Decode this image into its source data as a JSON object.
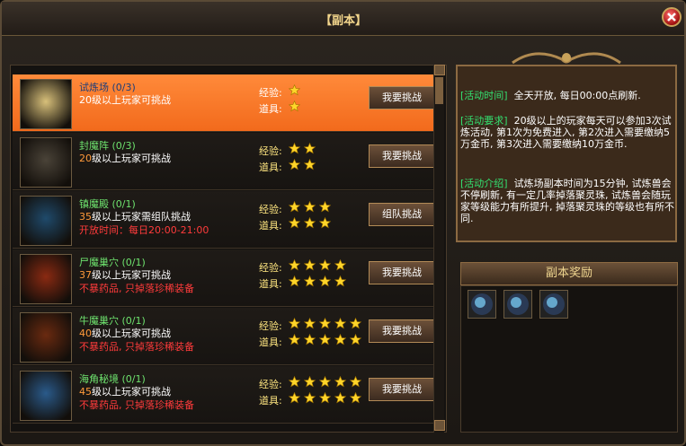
{
  "window": {
    "title": "【副本】"
  },
  "dungeons": [
    {
      "name": "试炼场 (0/3)",
      "level_num": "20",
      "level_text": "级以上玩家可挑战",
      "note": "",
      "exp_stars": 1,
      "item_stars": 1,
      "button": "我要挑战",
      "thumb_color": "#d8c07a"
    },
    {
      "name": "封魔阵 (0/3)",
      "level_num": "20",
      "level_text": "级以上玩家可挑战",
      "note": "",
      "exp_stars": 2,
      "item_stars": 2,
      "button": "我要挑战",
      "thumb_color": "#4a4338"
    },
    {
      "name": "镇魔殿 (0/1)",
      "level_num": "35",
      "level_text": "级以上玩家需组队挑战",
      "note": "开放时间：每日20:00-21:00",
      "exp_stars": 3,
      "item_stars": 3,
      "button": "组队挑战",
      "thumb_color": "#1f4a6b"
    },
    {
      "name": "尸魔巢穴 (0/1)",
      "level_num": "37",
      "level_text": "级以上玩家可挑战",
      "note": "不暴药品, 只掉落珍稀装备",
      "exp_stars": 4,
      "item_stars": 4,
      "button": "我要挑战",
      "thumb_color": "#8a2a12"
    },
    {
      "name": "牛魔巢穴 (0/1)",
      "level_num": "40",
      "level_text": "级以上玩家可挑战",
      "note": "不暴药品, 只掉落珍稀装备",
      "exp_stars": 5,
      "item_stars": 5,
      "button": "我要挑战",
      "thumb_color": "#6a2a10"
    },
    {
      "name": "海角秘境 (0/1)",
      "level_num": "45",
      "level_text": "级以上玩家可挑战",
      "note": "不暴药品, 只掉落珍稀装备",
      "exp_stars": 5,
      "item_stars": 5,
      "button": "我要挑战",
      "thumb_color": "#2a5a8a"
    }
  ],
  "labels": {
    "exp": "经验:",
    "item": "道具:"
  },
  "info": {
    "time_key": "[活动时间]",
    "time_val": "全天开放, 每日00:00点刷新.",
    "req_key": "[活动要求]",
    "req_val": "20级以上的玩家每天可以参加3次试炼活动, 第1次为免费进入, 第2次进入需要缴纳5万金币, 第3次进入需要缴纳10万金币.",
    "intro_key": "[活动介绍]",
    "intro_val": "试炼场副本时间为15分钟, 试炼兽会不停刷新, 有一定几率掉落聚灵珠, 试炼兽会随玩家等级能力有所提升, 掉落聚灵珠的等级也有所不同."
  },
  "rewards": {
    "title": "副本奖励",
    "count": 3
  }
}
